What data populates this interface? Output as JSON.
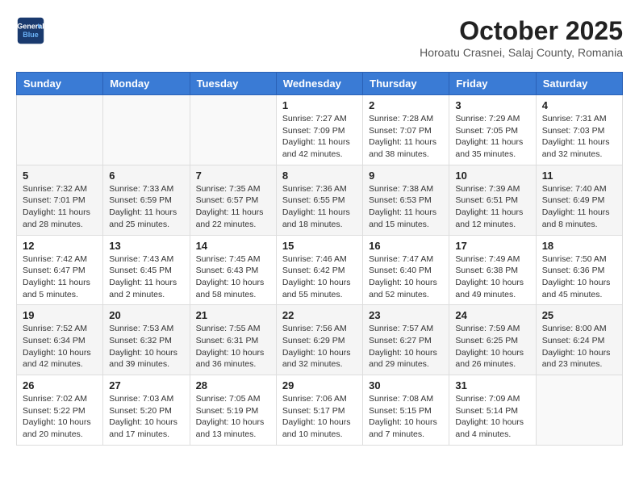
{
  "header": {
    "logo_line1": "General",
    "logo_line2": "Blue",
    "month": "October 2025",
    "location": "Horoatu Crasnei, Salaj County, Romania"
  },
  "weekdays": [
    "Sunday",
    "Monday",
    "Tuesday",
    "Wednesday",
    "Thursday",
    "Friday",
    "Saturday"
  ],
  "weeks": [
    [
      {
        "day": "",
        "info": ""
      },
      {
        "day": "",
        "info": ""
      },
      {
        "day": "",
        "info": ""
      },
      {
        "day": "1",
        "info": "Sunrise: 7:27 AM\nSunset: 7:09 PM\nDaylight: 11 hours\nand 42 minutes."
      },
      {
        "day": "2",
        "info": "Sunrise: 7:28 AM\nSunset: 7:07 PM\nDaylight: 11 hours\nand 38 minutes."
      },
      {
        "day": "3",
        "info": "Sunrise: 7:29 AM\nSunset: 7:05 PM\nDaylight: 11 hours\nand 35 minutes."
      },
      {
        "day": "4",
        "info": "Sunrise: 7:31 AM\nSunset: 7:03 PM\nDaylight: 11 hours\nand 32 minutes."
      }
    ],
    [
      {
        "day": "5",
        "info": "Sunrise: 7:32 AM\nSunset: 7:01 PM\nDaylight: 11 hours\nand 28 minutes."
      },
      {
        "day": "6",
        "info": "Sunrise: 7:33 AM\nSunset: 6:59 PM\nDaylight: 11 hours\nand 25 minutes."
      },
      {
        "day": "7",
        "info": "Sunrise: 7:35 AM\nSunset: 6:57 PM\nDaylight: 11 hours\nand 22 minutes."
      },
      {
        "day": "8",
        "info": "Sunrise: 7:36 AM\nSunset: 6:55 PM\nDaylight: 11 hours\nand 18 minutes."
      },
      {
        "day": "9",
        "info": "Sunrise: 7:38 AM\nSunset: 6:53 PM\nDaylight: 11 hours\nand 15 minutes."
      },
      {
        "day": "10",
        "info": "Sunrise: 7:39 AM\nSunset: 6:51 PM\nDaylight: 11 hours\nand 12 minutes."
      },
      {
        "day": "11",
        "info": "Sunrise: 7:40 AM\nSunset: 6:49 PM\nDaylight: 11 hours\nand 8 minutes."
      }
    ],
    [
      {
        "day": "12",
        "info": "Sunrise: 7:42 AM\nSunset: 6:47 PM\nDaylight: 11 hours\nand 5 minutes."
      },
      {
        "day": "13",
        "info": "Sunrise: 7:43 AM\nSunset: 6:45 PM\nDaylight: 11 hours\nand 2 minutes."
      },
      {
        "day": "14",
        "info": "Sunrise: 7:45 AM\nSunset: 6:43 PM\nDaylight: 10 hours\nand 58 minutes."
      },
      {
        "day": "15",
        "info": "Sunrise: 7:46 AM\nSunset: 6:42 PM\nDaylight: 10 hours\nand 55 minutes."
      },
      {
        "day": "16",
        "info": "Sunrise: 7:47 AM\nSunset: 6:40 PM\nDaylight: 10 hours\nand 52 minutes."
      },
      {
        "day": "17",
        "info": "Sunrise: 7:49 AM\nSunset: 6:38 PM\nDaylight: 10 hours\nand 49 minutes."
      },
      {
        "day": "18",
        "info": "Sunrise: 7:50 AM\nSunset: 6:36 PM\nDaylight: 10 hours\nand 45 minutes."
      }
    ],
    [
      {
        "day": "19",
        "info": "Sunrise: 7:52 AM\nSunset: 6:34 PM\nDaylight: 10 hours\nand 42 minutes."
      },
      {
        "day": "20",
        "info": "Sunrise: 7:53 AM\nSunset: 6:32 PM\nDaylight: 10 hours\nand 39 minutes."
      },
      {
        "day": "21",
        "info": "Sunrise: 7:55 AM\nSunset: 6:31 PM\nDaylight: 10 hours\nand 36 minutes."
      },
      {
        "day": "22",
        "info": "Sunrise: 7:56 AM\nSunset: 6:29 PM\nDaylight: 10 hours\nand 32 minutes."
      },
      {
        "day": "23",
        "info": "Sunrise: 7:57 AM\nSunset: 6:27 PM\nDaylight: 10 hours\nand 29 minutes."
      },
      {
        "day": "24",
        "info": "Sunrise: 7:59 AM\nSunset: 6:25 PM\nDaylight: 10 hours\nand 26 minutes."
      },
      {
        "day": "25",
        "info": "Sunrise: 8:00 AM\nSunset: 6:24 PM\nDaylight: 10 hours\nand 23 minutes."
      }
    ],
    [
      {
        "day": "26",
        "info": "Sunrise: 7:02 AM\nSunset: 5:22 PM\nDaylight: 10 hours\nand 20 minutes."
      },
      {
        "day": "27",
        "info": "Sunrise: 7:03 AM\nSunset: 5:20 PM\nDaylight: 10 hours\nand 17 minutes."
      },
      {
        "day": "28",
        "info": "Sunrise: 7:05 AM\nSunset: 5:19 PM\nDaylight: 10 hours\nand 13 minutes."
      },
      {
        "day": "29",
        "info": "Sunrise: 7:06 AM\nSunset: 5:17 PM\nDaylight: 10 hours\nand 10 minutes."
      },
      {
        "day": "30",
        "info": "Sunrise: 7:08 AM\nSunset: 5:15 PM\nDaylight: 10 hours\nand 7 minutes."
      },
      {
        "day": "31",
        "info": "Sunrise: 7:09 AM\nSunset: 5:14 PM\nDaylight: 10 hours\nand 4 minutes."
      },
      {
        "day": "",
        "info": ""
      }
    ]
  ]
}
